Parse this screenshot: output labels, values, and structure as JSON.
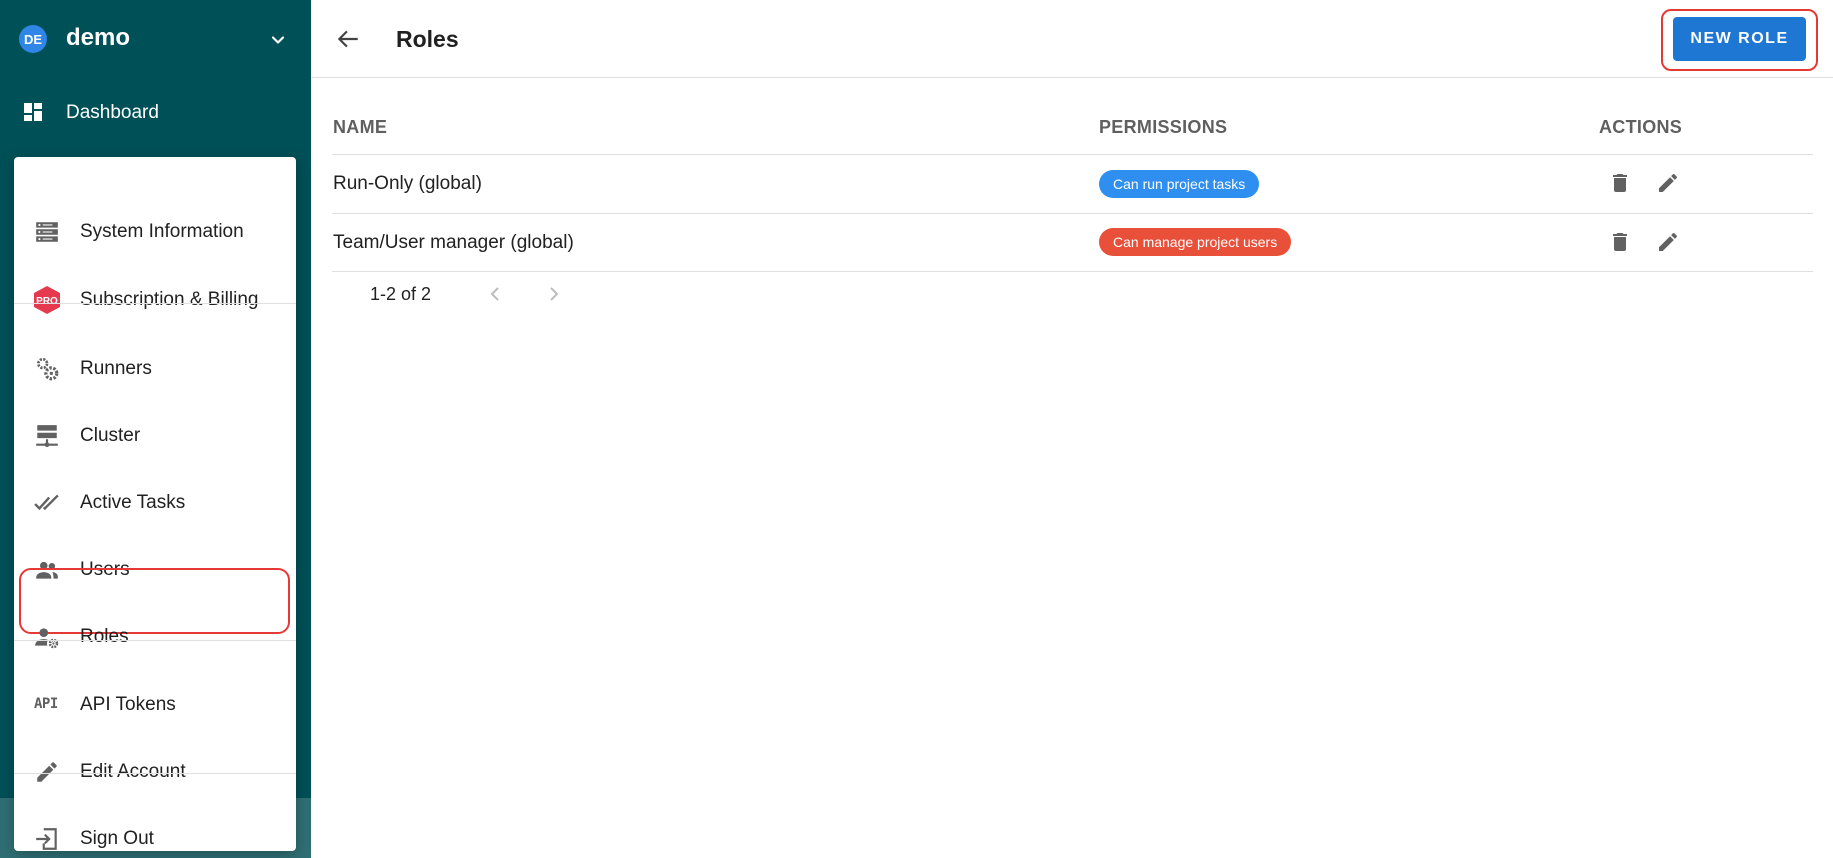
{
  "workspace": {
    "initials": "DE",
    "name": "demo"
  },
  "nav": {
    "dashboard": "Dashboard"
  },
  "menu": {
    "system_information": "System Information",
    "subscription_billing": "Subscription & Billing",
    "pro_badge": "PRO",
    "runners": "Runners",
    "cluster": "Cluster",
    "active_tasks": "Active Tasks",
    "users": "Users",
    "roles": "Roles",
    "api_tokens": "API Tokens",
    "api_icon_text": "API",
    "edit_account": "Edit Account",
    "sign_out": "Sign Out"
  },
  "header": {
    "title": "Roles",
    "new_role": "NEW ROLE"
  },
  "table": {
    "columns": {
      "name": "NAME",
      "permissions": "PERMISSIONS",
      "actions": "ACTIONS"
    },
    "rows": [
      {
        "name": "Run-Only (global)",
        "permission": "Can run project tasks",
        "permission_color": "#2f8ff0"
      },
      {
        "name": "Team/User manager (global)",
        "permission": "Can manage project users",
        "permission_color": "#e8503a"
      }
    ],
    "pagination": "1-2 of 2"
  },
  "colors": {
    "sidebar": "#005057",
    "accent": "#1f77d4",
    "highlight": "#e53935"
  },
  "icons": [
    "chevron-down-icon",
    "dashboard-icon",
    "server-icon",
    "pro-icon",
    "gears-icon",
    "cluster-icon",
    "double-check-icon",
    "users-icon",
    "user-cog-icon",
    "api-icon",
    "pencil-icon",
    "sign-out-icon",
    "arrow-back-icon",
    "trash-icon",
    "edit-icon",
    "chevron-left-icon",
    "chevron-right-icon"
  ]
}
